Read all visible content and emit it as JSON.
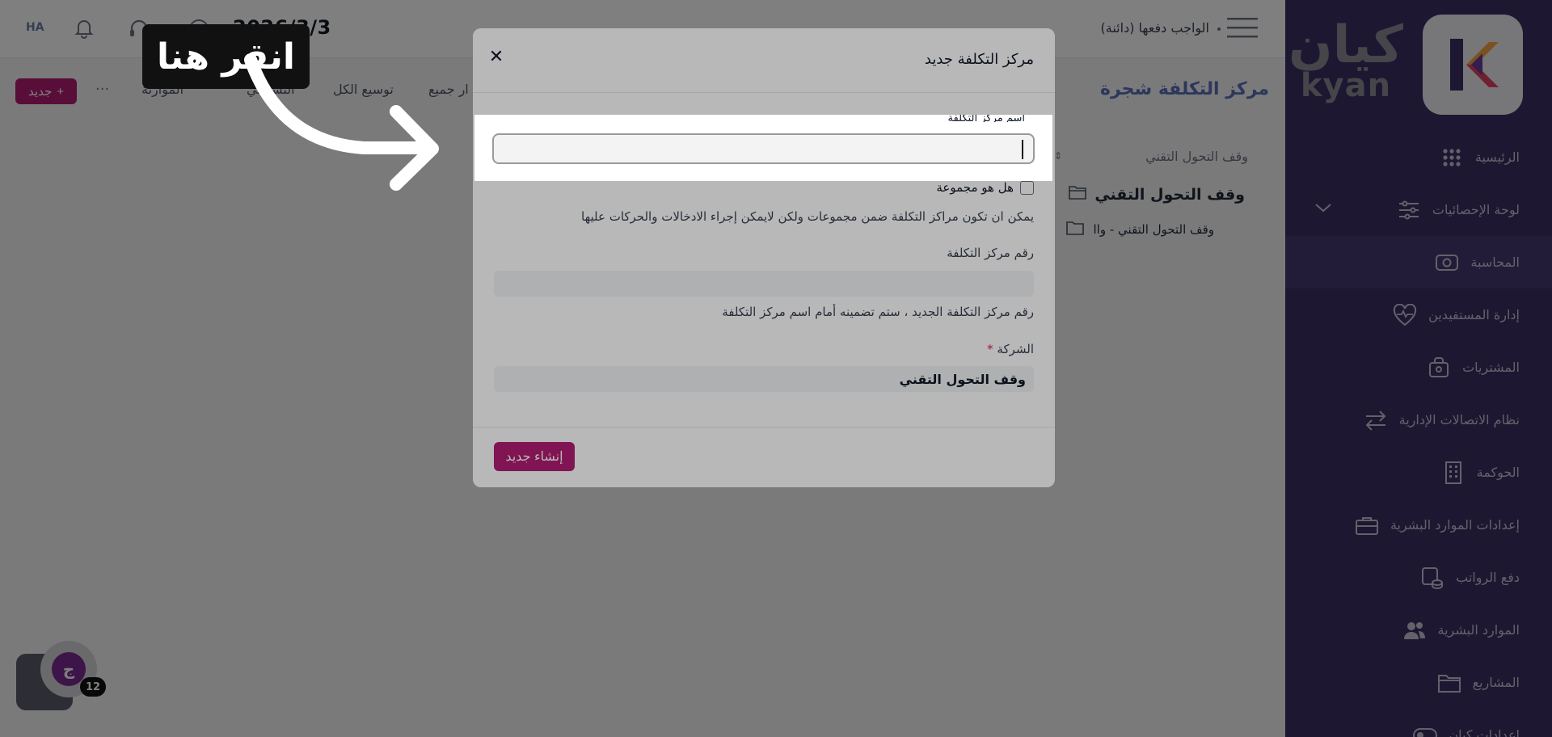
{
  "topbar": {
    "due_text": "الواجب دفعها (دائنة)",
    "date_text": "2026/3/3",
    "user_initials": "HA"
  },
  "sidebar": {
    "logo": {
      "arabic": "كيان",
      "latin": "kyan"
    },
    "items": [
      {
        "label": "الرئيسية",
        "icon": "dots-grid-icon"
      },
      {
        "label": "لوحة الإحصائيات",
        "icon": "sliders-icon"
      },
      {
        "label": "المحاسبة",
        "icon": "cash-icon"
      },
      {
        "label": "إدارة المستفيدين",
        "icon": "heart-pulse-icon"
      },
      {
        "label": "المشتريات",
        "icon": "box-icon"
      },
      {
        "label": "نظام الاتصالات الإدارية",
        "icon": "arrows-exchange-icon"
      },
      {
        "label": "الحوكمة",
        "icon": "building-icon"
      },
      {
        "label": "إعدادات الموارد البشرية",
        "icon": "briefcase-icon"
      },
      {
        "label": "دفع الرواتب",
        "icon": "coins-icon"
      },
      {
        "label": "الموارد البشرية",
        "icon": "users-icon"
      },
      {
        "label": "المشاريع",
        "icon": "folder-icon"
      },
      {
        "label": "إعدادات كيان",
        "icon": "toggle-icon"
      }
    ]
  },
  "page": {
    "title": "مركز التكلفة شجرة",
    "toolbar": {
      "new_label": "جديد",
      "links": [
        "توسيع الكل",
        "ار جميع",
        "التشغيلي",
        "الموازنة"
      ]
    },
    "tree_filter": "وقف التحول التقني",
    "tree_root": "وقف التحول التقني",
    "tree_child": "وقف التحول التقني - واا"
  },
  "modal": {
    "title": "مركز التكلفة جديد",
    "name_label": "اسم مركز التكلفة",
    "name_value": "",
    "is_group_label": "هل هو مجموعة",
    "is_group_checked": false,
    "is_group_help": "يمكن ان تكون مراكز التكلفة ضمن مجموعات ولكن لايمكن إجراء الادخالات والحركات عليها",
    "number_label": "رقم مركز التكلفة",
    "number_value": "",
    "number_help": "رقم مركز التكلفة الجديد ، ستم تضمينه أمام اسم مركز التكلفة",
    "company_label": "الشركة",
    "company_required_mark": "*",
    "company_value": "وقف التحول التقني",
    "create_button": "إنشاء جديد"
  },
  "tutorial": {
    "callout_text": "انقر هنا"
  },
  "chat_widget": {
    "badge_count": "12"
  },
  "colors": {
    "sidebar_bg": "#3a2f63",
    "accent": "#b31d73",
    "title_blue": "#5a6fb8"
  }
}
